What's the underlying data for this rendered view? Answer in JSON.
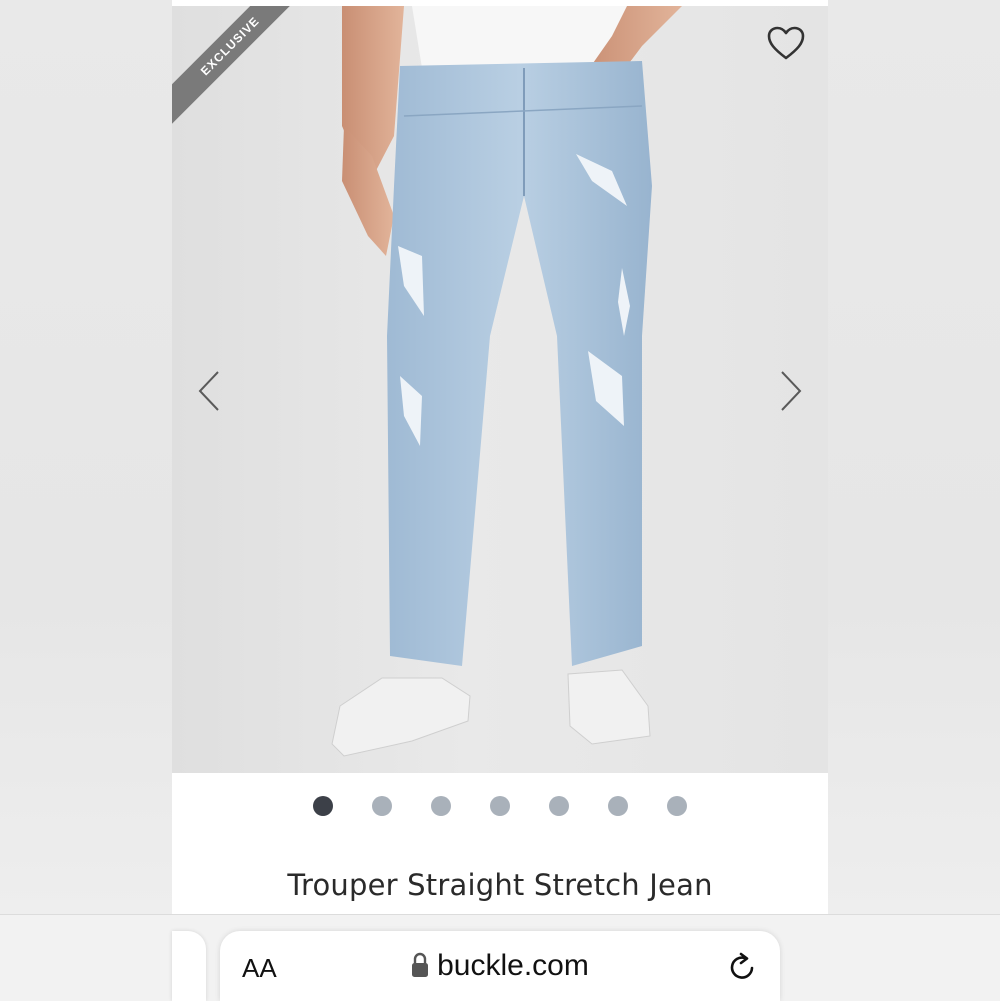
{
  "product": {
    "badge": "EXCLUSIVE",
    "title": "Trouper Straight Stretch Jean",
    "image_count": 7,
    "active_image_index": 0
  },
  "gallery": {
    "wishlist_icon": "heart-outline-icon",
    "prev_icon": "chevron-left-icon",
    "next_icon": "chevron-right-icon"
  },
  "browser": {
    "text_size_label": "AA",
    "url": "buckle.com",
    "lock_icon": "lock-icon",
    "reload_icon": "reload-icon"
  },
  "colors": {
    "ribbon": "#7a7a7a",
    "dot_active": "#3c4048",
    "dot_inactive": "#a9b1ba",
    "denim": "#a9c4dc"
  }
}
